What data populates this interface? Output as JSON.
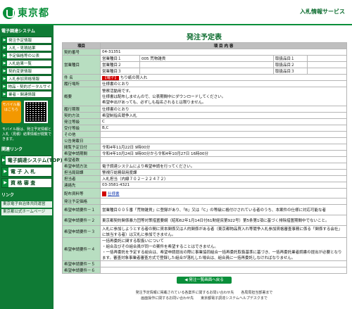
{
  "header": {
    "logo_text": "東京都",
    "service_name": "入札情報サービス"
  },
  "sidebar": {
    "menu_head": "電子調達システム",
    "items": [
      "発注予定情報",
      "入札・見積結果",
      "予定価格等の公表",
      "入札結果一覧",
      "契約変更情報",
      "入札参加資格情報",
      "物品・契約ポータルサイト",
      "業者・関連情報"
    ],
    "mobile_label": "モバイル版はこちら",
    "mobile_note": "モバイル版は、発注予定情報と入札（見積）結果情報が閲覧できます。",
    "links_head": "関連リンク",
    "big_items": [
      "電子調達システム(TOP)",
      "電 子 入 札",
      "資 格 審 査"
    ],
    "links_head2": "リンク",
    "links": [
      "東京電子自治体共同運営",
      "東京都公式ホームページ"
    ]
  },
  "main": {
    "title": "発注予定表",
    "col_item": "項目",
    "col_content": "項 目 内 容",
    "rows": {
      "contract_no_label": "契約番号",
      "contract_no": "04-31351",
      "category_label": "営業種目",
      "cat1_label": "営業種目１",
      "cat1_value": "005 荒物雑貨",
      "cat2_label": "営業種目２",
      "cat3_label": "営業種目３",
      "sub1_label": "取扱品目１",
      "sub2_label": "取扱品目２",
      "sub3_label": "取扱品目３",
      "subject_label": "件 名",
      "subject_tag": "【電子】",
      "subject": "ちり紙の買入れ",
      "place_label": "履行場所",
      "place": "仕様書のとおり",
      "overview_label": "概要",
      "overview": [
        "警察活動用です。",
        "仕様書は配布しませんので、公表期間中にダウンロードしてください。",
        "希望申出があっても、必ずしも指名されるとは限りません。"
      ],
      "period_label": "履行期限",
      "period": "仕様書のとおり",
      "method_label": "契約方法",
      "method": "希望制指名競争入札",
      "grade_label": "発注等級",
      "grade": "C",
      "req_grade_label": "受付等級",
      "req_grade": "B,C",
      "other_label": "その他",
      "pub_date_label": "公告掲載日",
      "pub_start_label": "閲覧予定日付",
      "pub_start": "令和4年11月22日 9時00分",
      "apply_label": "希望申請期間",
      "apply": "令和4年10月24日 9時00分から令和4年10月27日 16時00分",
      "applicants_label": "希望者数",
      "apply_method_label": "希望申請方法",
      "apply_method": "電子調達システムにより希望申請を行ってください。",
      "dept_label": "担当局部課",
      "dept": "警視庁総務部用度課",
      "person_label": "担当者",
      "person": "入札担当（内線７０２－２２４７２）",
      "contact_label": "連絡先",
      "contact": "03-3581-4321",
      "doc_label": "配布資料等",
      "doc": "仕様書",
      "grade2_label": "発注予定価格",
      "req1_label": "希望申請要件－１",
      "req1": "営業種目００５番「荒物雑貨」に登録があり、「B」又は「C」の等級に格付けされている者のうち、本案件の仕様に対応可能な者",
      "req2_label": "希望申請要件－２",
      "req2": "東京都契約関係暴力団等対策措置要綱（昭和62年1月14日付61財経庶第922号）第5条第1項に基づく排除措置期間中でないこと。",
      "req3_label": "希望申請要件－３",
      "req3": "入札に参加しようとする者の間に資本関係又は人的関係がある者（東京都物品買入れ等競争入札参加資格審査事務に係る「関係する会社」に該当する者）は又札に参加できません。",
      "req4_label": "希望申請要件－４",
      "req4": [
        "一括再委託に関する取扱いについて",
        "・組合及びその組合員が同一の案件を希望することはできません。",
        "・一括再委託を予定する組合は、希望申請提出の際に事業協同組合一括再委託取扱基準に基づき、一括再委託業者調書の提出が必要となります。審査対象事業者審査方式で登録した組合が落札した場合は、組合員に一括再委託しなければなりません。"
      ],
      "req5_label": "希望申請要件－５",
      "req6_label": "希望申請要件－６"
    },
    "back_button": "発注一覧画面へ戻る"
  },
  "footer": {
    "line1": "発注予定情報に掲載されている各案件に関するお問い合わせ先　　各局局担当部署まで",
    "line2": "画面操作に関するお問い合わせ先　　東京都電子調達システムヘルプデスクまで"
  }
}
